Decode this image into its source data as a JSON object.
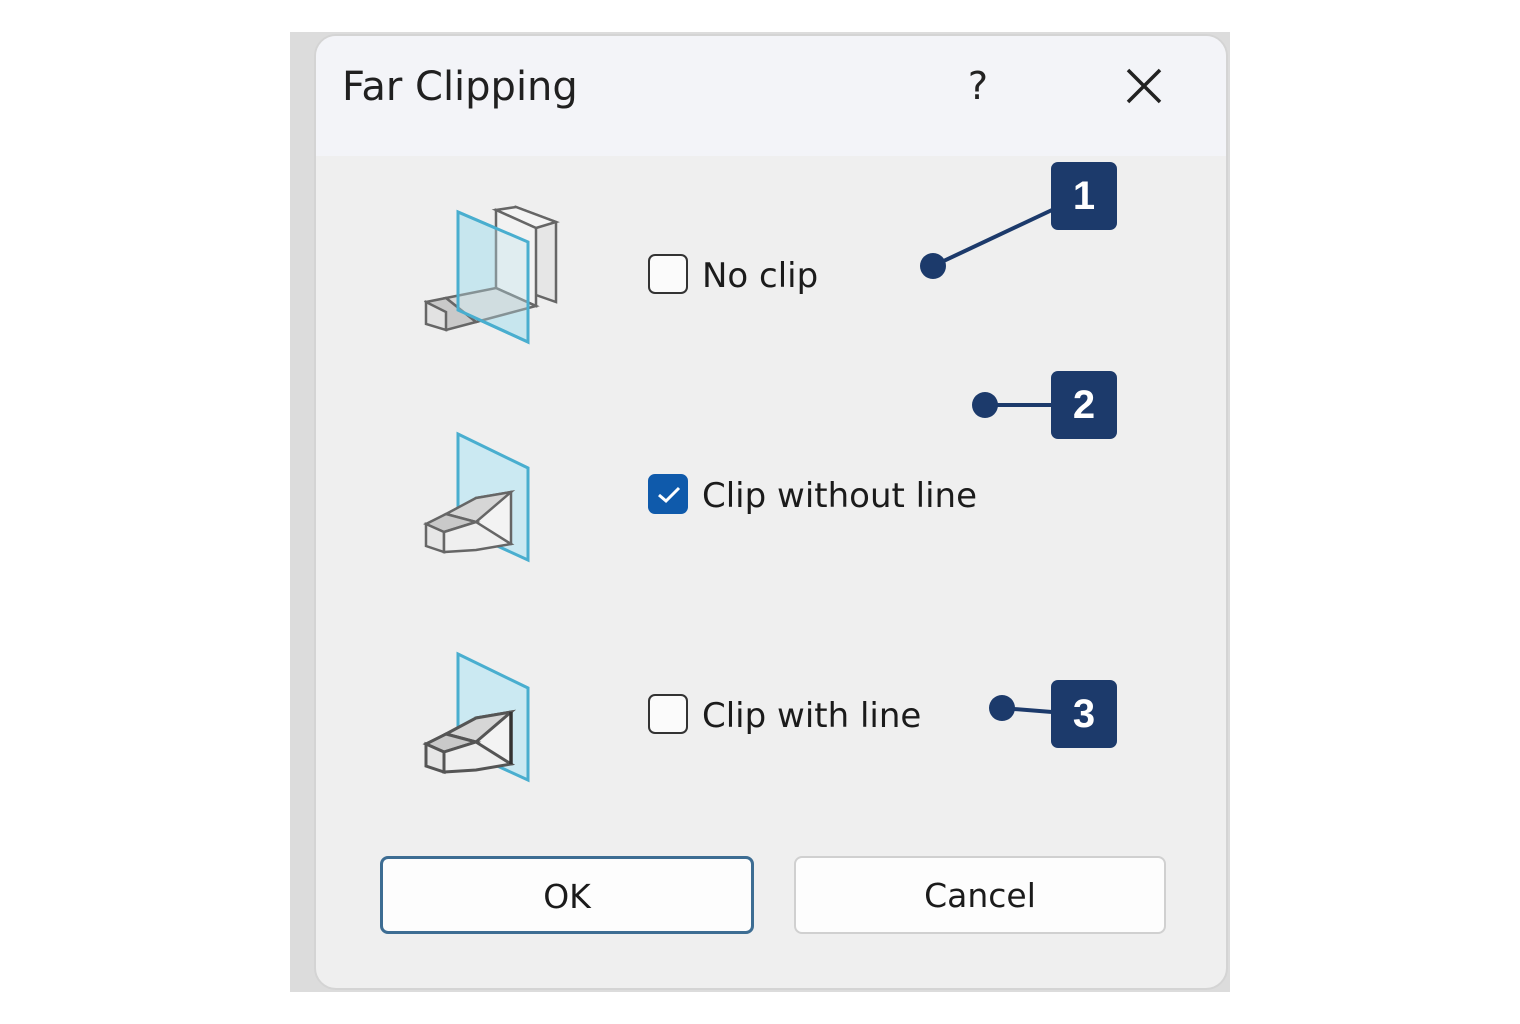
{
  "dialog": {
    "title": "Far Clipping",
    "help_label": "?",
    "close_icon": "close-icon"
  },
  "options": [
    {
      "label": "No clip",
      "checked": false,
      "icon": "no-clip-icon"
    },
    {
      "label": "Clip without line",
      "checked": true,
      "icon": "clip-without-line-icon"
    },
    {
      "label": "Clip with line",
      "checked": false,
      "icon": "clip-with-line-icon"
    }
  ],
  "buttons": {
    "ok_label": "OK",
    "cancel_label": "Cancel"
  },
  "callouts": [
    "1",
    "2",
    "3"
  ],
  "colors": {
    "accent": "#0f5aab",
    "callout": "#1c3a6b"
  }
}
